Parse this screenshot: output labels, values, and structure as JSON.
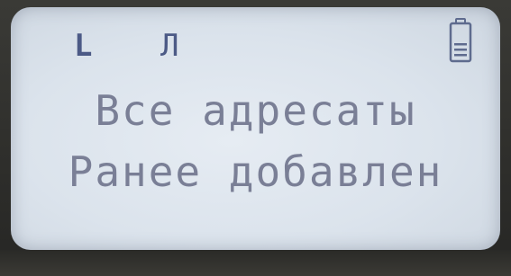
{
  "status_bar": {
    "left_indicator": "L",
    "signal_indicator": "Л",
    "battery_icon": "battery-icon"
  },
  "display": {
    "line1": "Все адресаты",
    "line2": "Ранее добавлен"
  },
  "colors": {
    "lcd_background": "#dbe3ec",
    "lcd_text": "#7a7f96",
    "status_icons": "#4c5a86",
    "bezel": "#2e2e2b"
  }
}
